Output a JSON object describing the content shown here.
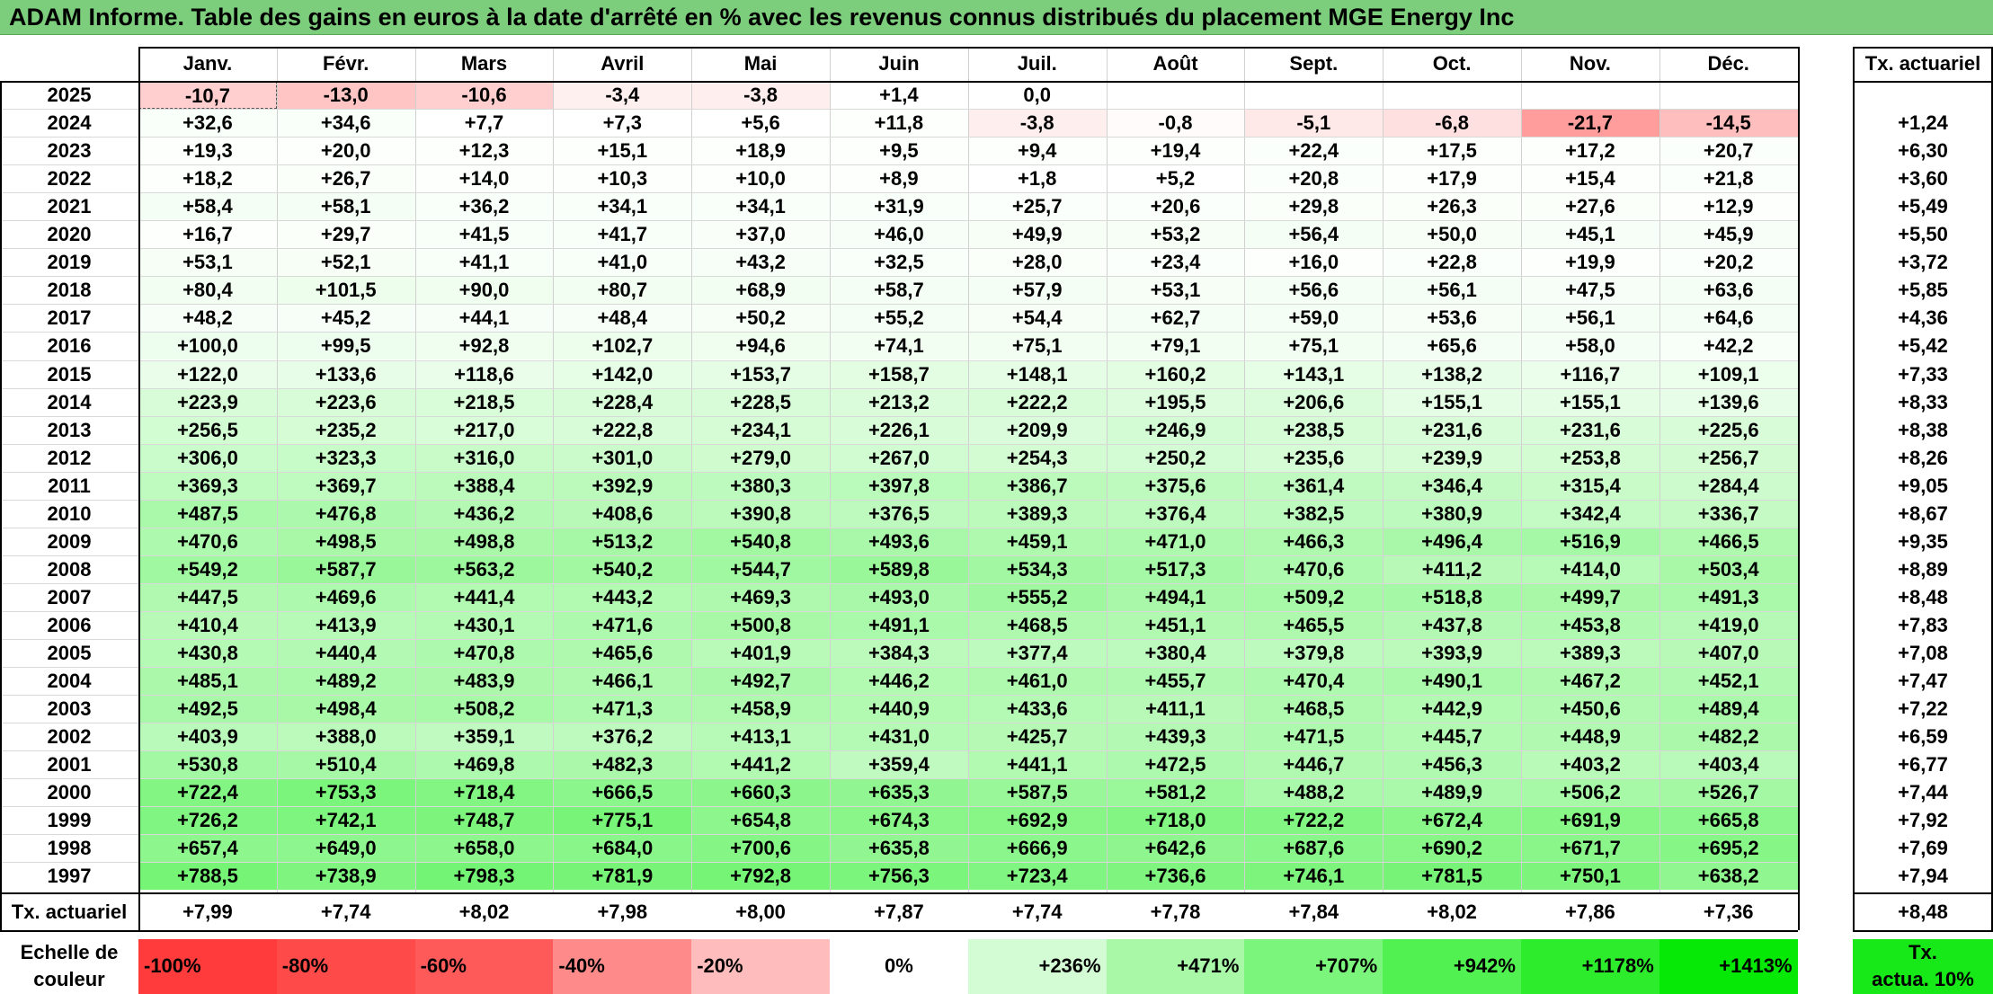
{
  "title": "ADAM Informe. Table des gains en euros à la date d'arrêté en % avec les revenus connus distribués du placement MGE Energy Inc",
  "months": [
    "Janv.",
    "Févr.",
    "Mars",
    "Avril",
    "Mai",
    "Juin",
    "Juil.",
    "Août",
    "Sept.",
    "Oct.",
    "Nov.",
    "Déc."
  ],
  "rate_header": "Tx. actuariel",
  "rows": [
    {
      "year": "2025",
      "values": [
        "-10,7",
        "-13,0",
        "-10,6",
        "-3,4",
        "-3,8",
        "+1,4",
        "0,0",
        "",
        "",
        "",
        "",
        ""
      ],
      "rate": ""
    },
    {
      "year": "2024",
      "values": [
        "+32,6",
        "+34,6",
        "+7,7",
        "+7,3",
        "+5,6",
        "+11,8",
        "-3,8",
        "-0,8",
        "-5,1",
        "-6,8",
        "-21,7",
        "-14,5"
      ],
      "rate": "+1,24"
    },
    {
      "year": "2023",
      "values": [
        "+19,3",
        "+20,0",
        "+12,3",
        "+15,1",
        "+18,9",
        "+9,5",
        "+9,4",
        "+19,4",
        "+22,4",
        "+17,5",
        "+17,2",
        "+20,7"
      ],
      "rate": "+6,30"
    },
    {
      "year": "2022",
      "values": [
        "+18,2",
        "+26,7",
        "+14,0",
        "+10,3",
        "+10,0",
        "+8,9",
        "+1,8",
        "+5,2",
        "+20,8",
        "+17,9",
        "+15,4",
        "+21,8"
      ],
      "rate": "+3,60"
    },
    {
      "year": "2021",
      "values": [
        "+58,4",
        "+58,1",
        "+36,2",
        "+34,1",
        "+34,1",
        "+31,9",
        "+25,7",
        "+20,6",
        "+29,8",
        "+26,3",
        "+27,6",
        "+12,9"
      ],
      "rate": "+5,49"
    },
    {
      "year": "2020",
      "values": [
        "+16,7",
        "+29,7",
        "+41,5",
        "+41,7",
        "+37,0",
        "+46,0",
        "+49,9",
        "+53,2",
        "+56,4",
        "+50,0",
        "+45,1",
        "+45,9"
      ],
      "rate": "+5,50"
    },
    {
      "year": "2019",
      "values": [
        "+53,1",
        "+52,1",
        "+41,1",
        "+41,0",
        "+43,2",
        "+32,5",
        "+28,0",
        "+23,4",
        "+16,0",
        "+22,8",
        "+19,9",
        "+20,2"
      ],
      "rate": "+3,72"
    },
    {
      "year": "2018",
      "values": [
        "+80,4",
        "+101,5",
        "+90,0",
        "+80,7",
        "+68,9",
        "+58,7",
        "+57,9",
        "+53,1",
        "+56,6",
        "+56,1",
        "+47,5",
        "+63,6"
      ],
      "rate": "+5,85"
    },
    {
      "year": "2017",
      "values": [
        "+48,2",
        "+45,2",
        "+44,1",
        "+48,4",
        "+50,2",
        "+55,2",
        "+54,4",
        "+62,7",
        "+59,0",
        "+53,6",
        "+56,1",
        "+64,6"
      ],
      "rate": "+4,36"
    },
    {
      "year": "2016",
      "values": [
        "+100,0",
        "+99,5",
        "+92,8",
        "+102,7",
        "+94,6",
        "+74,1",
        "+75,1",
        "+79,1",
        "+75,1",
        "+65,6",
        "+58,0",
        "+42,2"
      ],
      "rate": "+5,42"
    },
    {
      "year": "2015",
      "values": [
        "+122,0",
        "+133,6",
        "+118,6",
        "+142,0",
        "+153,7",
        "+158,7",
        "+148,1",
        "+160,2",
        "+143,1",
        "+138,2",
        "+116,7",
        "+109,1"
      ],
      "rate": "+7,33"
    },
    {
      "year": "2014",
      "values": [
        "+223,9",
        "+223,6",
        "+218,5",
        "+228,4",
        "+228,5",
        "+213,2",
        "+222,2",
        "+195,5",
        "+206,6",
        "+155,1",
        "+155,1",
        "+139,6"
      ],
      "rate": "+8,33"
    },
    {
      "year": "2013",
      "values": [
        "+256,5",
        "+235,2",
        "+217,0",
        "+222,8",
        "+234,1",
        "+226,1",
        "+209,9",
        "+246,9",
        "+238,5",
        "+231,6",
        "+231,6",
        "+225,6"
      ],
      "rate": "+8,38"
    },
    {
      "year": "2012",
      "values": [
        "+306,0",
        "+323,3",
        "+316,0",
        "+301,0",
        "+279,0",
        "+267,0",
        "+254,3",
        "+250,2",
        "+235,6",
        "+239,9",
        "+253,8",
        "+256,7"
      ],
      "rate": "+8,26"
    },
    {
      "year": "2011",
      "values": [
        "+369,3",
        "+369,7",
        "+388,4",
        "+392,9",
        "+380,3",
        "+397,8",
        "+386,7",
        "+375,6",
        "+361,4",
        "+346,4",
        "+315,4",
        "+284,4"
      ],
      "rate": "+9,05"
    },
    {
      "year": "2010",
      "values": [
        "+487,5",
        "+476,8",
        "+436,2",
        "+408,6",
        "+390,8",
        "+376,5",
        "+389,3",
        "+376,4",
        "+382,5",
        "+380,9",
        "+342,4",
        "+336,7"
      ],
      "rate": "+8,67"
    },
    {
      "year": "2009",
      "values": [
        "+470,6",
        "+498,5",
        "+498,8",
        "+513,2",
        "+540,8",
        "+493,6",
        "+459,1",
        "+471,0",
        "+466,3",
        "+496,4",
        "+516,9",
        "+466,5"
      ],
      "rate": "+9,35"
    },
    {
      "year": "2008",
      "values": [
        "+549,2",
        "+587,7",
        "+563,2",
        "+540,2",
        "+544,7",
        "+589,8",
        "+534,3",
        "+517,3",
        "+470,6",
        "+411,2",
        "+414,0",
        "+503,4"
      ],
      "rate": "+8,89"
    },
    {
      "year": "2007",
      "values": [
        "+447,5",
        "+469,6",
        "+441,4",
        "+443,2",
        "+469,3",
        "+493,0",
        "+555,2",
        "+494,1",
        "+509,2",
        "+518,8",
        "+499,7",
        "+491,3"
      ],
      "rate": "+8,48"
    },
    {
      "year": "2006",
      "values": [
        "+410,4",
        "+413,9",
        "+430,1",
        "+471,6",
        "+500,8",
        "+491,1",
        "+468,5",
        "+451,1",
        "+465,5",
        "+437,8",
        "+453,8",
        "+419,0"
      ],
      "rate": "+7,83"
    },
    {
      "year": "2005",
      "values": [
        "+430,8",
        "+440,4",
        "+470,8",
        "+465,6",
        "+401,9",
        "+384,3",
        "+377,4",
        "+380,4",
        "+379,8",
        "+393,9",
        "+389,3",
        "+407,0"
      ],
      "rate": "+7,08"
    },
    {
      "year": "2004",
      "values": [
        "+485,1",
        "+489,2",
        "+483,9",
        "+466,1",
        "+492,7",
        "+446,2",
        "+461,0",
        "+455,7",
        "+470,4",
        "+490,1",
        "+467,2",
        "+452,1"
      ],
      "rate": "+7,47"
    },
    {
      "year": "2003",
      "values": [
        "+492,5",
        "+498,4",
        "+508,2",
        "+471,3",
        "+458,9",
        "+440,9",
        "+433,6",
        "+411,1",
        "+468,5",
        "+442,9",
        "+450,6",
        "+489,4"
      ],
      "rate": "+7,22"
    },
    {
      "year": "2002",
      "values": [
        "+403,9",
        "+388,0",
        "+359,1",
        "+376,2",
        "+413,1",
        "+431,0",
        "+425,7",
        "+439,3",
        "+471,5",
        "+445,7",
        "+448,9",
        "+482,2"
      ],
      "rate": "+6,59"
    },
    {
      "year": "2001",
      "values": [
        "+530,8",
        "+510,4",
        "+469,8",
        "+482,3",
        "+441,2",
        "+359,4",
        "+441,1",
        "+472,5",
        "+446,7",
        "+456,3",
        "+403,2",
        "+403,4"
      ],
      "rate": "+6,77"
    },
    {
      "year": "2000",
      "values": [
        "+722,4",
        "+753,3",
        "+718,4",
        "+666,5",
        "+660,3",
        "+635,3",
        "+587,5",
        "+581,2",
        "+488,2",
        "+489,9",
        "+506,2",
        "+526,7"
      ],
      "rate": "+7,44"
    },
    {
      "year": "1999",
      "values": [
        "+726,2",
        "+742,1",
        "+748,7",
        "+775,1",
        "+654,8",
        "+674,3",
        "+692,9",
        "+718,0",
        "+722,2",
        "+672,4",
        "+691,9",
        "+665,8"
      ],
      "rate": "+7,92"
    },
    {
      "year": "1998",
      "values": [
        "+657,4",
        "+649,0",
        "+658,0",
        "+684,0",
        "+700,6",
        "+635,8",
        "+666,9",
        "+642,6",
        "+687,6",
        "+690,2",
        "+671,7",
        "+695,2"
      ],
      "rate": "+7,69"
    },
    {
      "year": "1997",
      "values": [
        "+788,5",
        "+738,9",
        "+798,3",
        "+781,9",
        "+792,8",
        "+756,3",
        "+723,4",
        "+736,6",
        "+746,1",
        "+781,5",
        "+750,1",
        "+638,2"
      ],
      "rate": "+7,94"
    }
  ],
  "footer": {
    "label": "Tx. actuariel",
    "values": [
      "+7,99",
      "+7,74",
      "+8,02",
      "+7,98",
      "+8,00",
      "+7,87",
      "+7,74",
      "+7,78",
      "+7,84",
      "+8,02",
      "+7,86",
      "+7,36"
    ],
    "total": "+8,48"
  },
  "scale": {
    "label_line1": "Echelle de",
    "label_line2": "couleur",
    "steps": [
      {
        "text": "-100%",
        "color": "#ff3b3b",
        "align": "left"
      },
      {
        "text": "-80%",
        "color": "#ff4a4a",
        "align": "left"
      },
      {
        "text": "-60%",
        "color": "#ff5a5a",
        "align": "left"
      },
      {
        "text": "-40%",
        "color": "#ff8a8a",
        "align": "left"
      },
      {
        "text": "-20%",
        "color": "#ffbcbc",
        "align": "left"
      },
      {
        "text": "0%",
        "color": "#ffffff",
        "align": "center"
      },
      {
        "text": "+236%",
        "color": "#d4fcd4",
        "align": "right"
      },
      {
        "text": "+471%",
        "color": "#a8f8a8",
        "align": "right"
      },
      {
        "text": "+707%",
        "color": "#7cf57c",
        "align": "right"
      },
      {
        "text": "+942%",
        "color": "#52f152",
        "align": "right"
      },
      {
        "text": "+1178%",
        "color": "#2cec2c",
        "align": "right"
      },
      {
        "text": "+1413%",
        "color": "#06e806",
        "align": "right"
      }
    ],
    "rate_line1": "Tx.",
    "rate_line2": "actua. 10%",
    "rate_color": "#17e817"
  },
  "colors": {
    "title_bg": "#7ccd7c",
    "negative": "#ff6a6a",
    "positive": "#40f040"
  }
}
